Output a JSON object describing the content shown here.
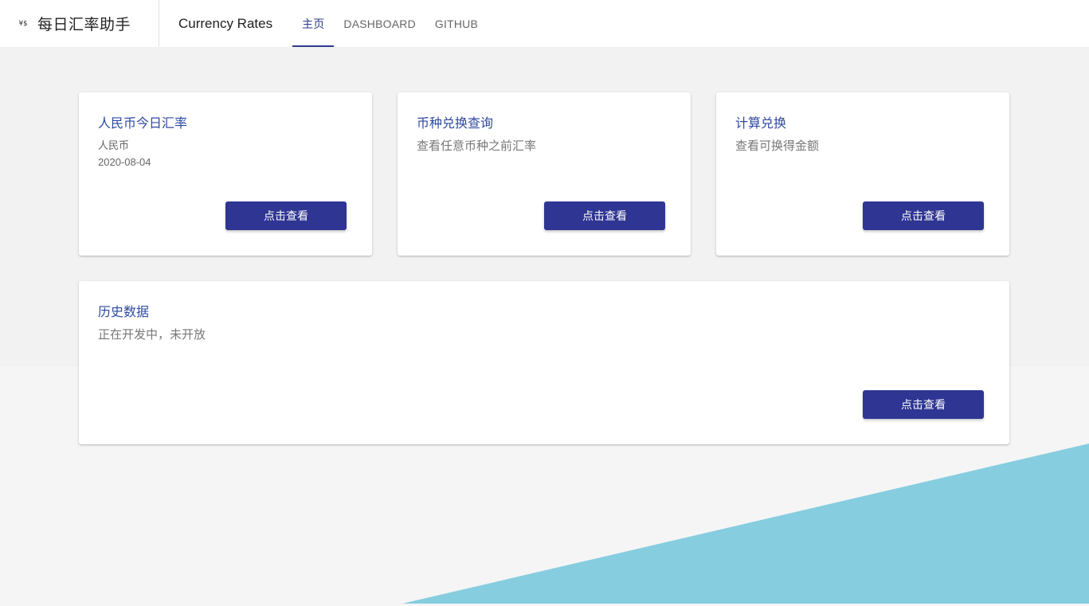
{
  "brand": {
    "logo_text": "¥$",
    "name": "每日汇率助手"
  },
  "app_title": "Currency Rates",
  "tabs": [
    {
      "label": "主页",
      "active": true
    },
    {
      "label": "DASHBOARD",
      "active": false
    },
    {
      "label": "GITHUB",
      "active": false
    }
  ],
  "cards": [
    {
      "title": "人民币今日汇率",
      "meta": [
        "人民币",
        "2020-08-04"
      ],
      "button": "点击查看"
    },
    {
      "title": "币种兑换查询",
      "subtitle": "查看任意币种之前汇率",
      "button": "点击查看"
    },
    {
      "title": "计算兑换",
      "subtitle": "查看可换得金额",
      "button": "点击查看"
    },
    {
      "title": "历史数据",
      "subtitle": "正在开发中，未开放",
      "button": "点击查看"
    }
  ],
  "colors": {
    "accent": "#2e3592",
    "title_blue": "#2e4aa0",
    "decor_triangle": "#86cde0",
    "band_gray": "#f2f2f2"
  }
}
